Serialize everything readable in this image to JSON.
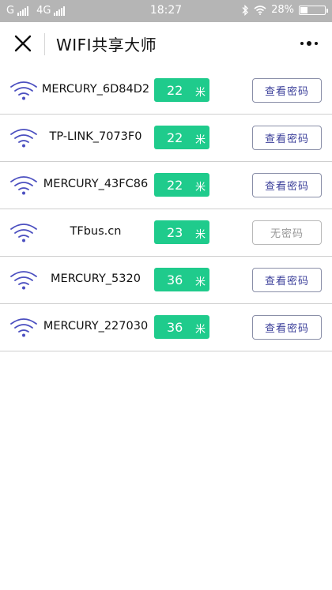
{
  "status_bar": {
    "carrier1": "G",
    "carrier2": "4G",
    "time": "18:27",
    "battery_text": "28%",
    "battery_level": 0.28
  },
  "header": {
    "title": "WIFI共享大师"
  },
  "colors": {
    "distance_badge": "#1fcb8c",
    "wifi_icon": "#4b4fc0",
    "button_text": "#3b3f9a"
  },
  "networks": [
    {
      "ssid": "MERCURY_6D84D2",
      "distance": "22",
      "unit": "米",
      "action": "查看密码",
      "has_password": true
    },
    {
      "ssid": "TP-LINK_7073F0",
      "distance": "22",
      "unit": "米",
      "action": "查看密码",
      "has_password": true
    },
    {
      "ssid": "MERCURY_43FC86",
      "distance": "22",
      "unit": "米",
      "action": "查看密码",
      "has_password": true
    },
    {
      "ssid": "TFbus.cn",
      "distance": "23",
      "unit": "米",
      "action": "无密码",
      "has_password": false
    },
    {
      "ssid": "MERCURY_5320",
      "distance": "36",
      "unit": "米",
      "action": "查看密码",
      "has_password": true
    },
    {
      "ssid": "MERCURY_227030",
      "distance": "36",
      "unit": "米",
      "action": "查看密码",
      "has_password": true
    }
  ]
}
